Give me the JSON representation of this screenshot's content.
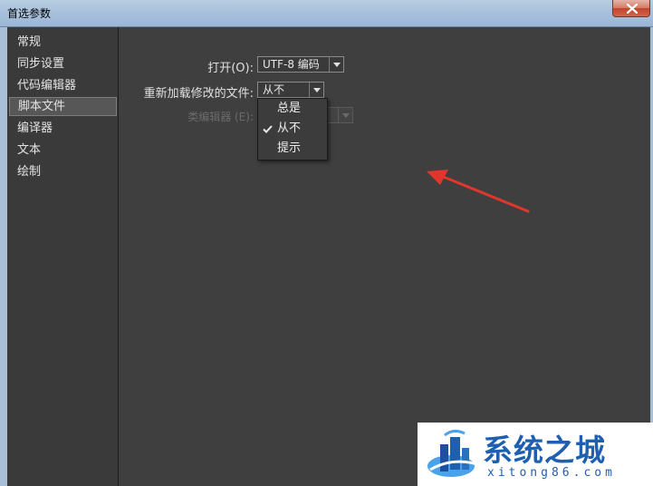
{
  "window": {
    "title": "首选参数"
  },
  "sidebar": {
    "items": [
      {
        "label": "常规",
        "selected": false
      },
      {
        "label": "同步设置",
        "selected": false
      },
      {
        "label": "代码编辑器",
        "selected": false
      },
      {
        "label": "脚本文件",
        "selected": true
      },
      {
        "label": "编译器",
        "selected": false
      },
      {
        "label": "文本",
        "selected": false
      },
      {
        "label": "绘制",
        "selected": false
      }
    ]
  },
  "form": {
    "open_label": "打开(O):",
    "open_value": "UTF-8 编码",
    "reload_label": "重新加载修改的文件:",
    "reload_value": "从不",
    "class_editor_label": "类编辑器 (E):",
    "class_editor_value": ""
  },
  "dropdown": {
    "options": [
      {
        "label": "总是",
        "checked": false
      },
      {
        "label": "从不",
        "checked": true
      },
      {
        "label": "提示",
        "checked": false
      }
    ]
  },
  "watermark": {
    "title": "系统之城",
    "domain": "xitong86.com"
  },
  "colors": {
    "panel": "#3f3f3f",
    "sidebar": "#3a3a3a",
    "selected": "#575757",
    "annotation_arrow": "#e0362c",
    "watermark_blue": "#1e5fb0"
  },
  "icons": [
    "close-icon",
    "check-icon",
    "dropdown-arrow-icon",
    "annotation-arrow",
    "logo-icon"
  ]
}
